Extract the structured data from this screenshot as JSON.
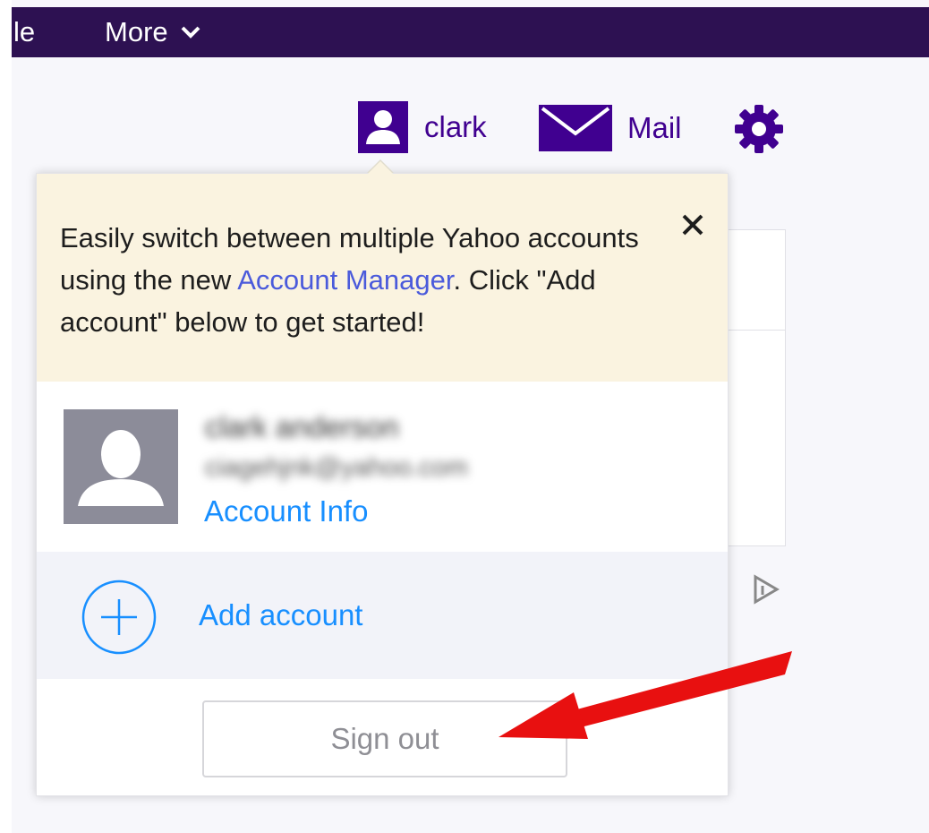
{
  "nav": {
    "left_item": "le",
    "more_label": "More"
  },
  "header": {
    "user_label": "clark",
    "mail_label": "Mail"
  },
  "popup": {
    "promo": {
      "text_before": "Easily switch between multiple Yahoo accounts using the new ",
      "link": "Account Manager",
      "text_after": ". Click \"Add account\" below to get started!"
    },
    "account": {
      "name": "clark anderson",
      "email": "ciagehjnk@yahoo.com",
      "info_link": "Account Info"
    },
    "add_account_label": "Add account",
    "sign_out_label": "Sign out"
  },
  "colors": {
    "nav_bg": "#2d1152",
    "brand_purple": "#400090",
    "link_blue": "#188fff",
    "promo_bg": "#faf3e0",
    "arrow_red": "#e81010"
  },
  "icons": {
    "user": "user-icon",
    "mail": "mail-icon",
    "settings": "gear-icon",
    "close": "close-icon",
    "add": "plus-circle-icon",
    "ad": "ad-choices-icon"
  }
}
